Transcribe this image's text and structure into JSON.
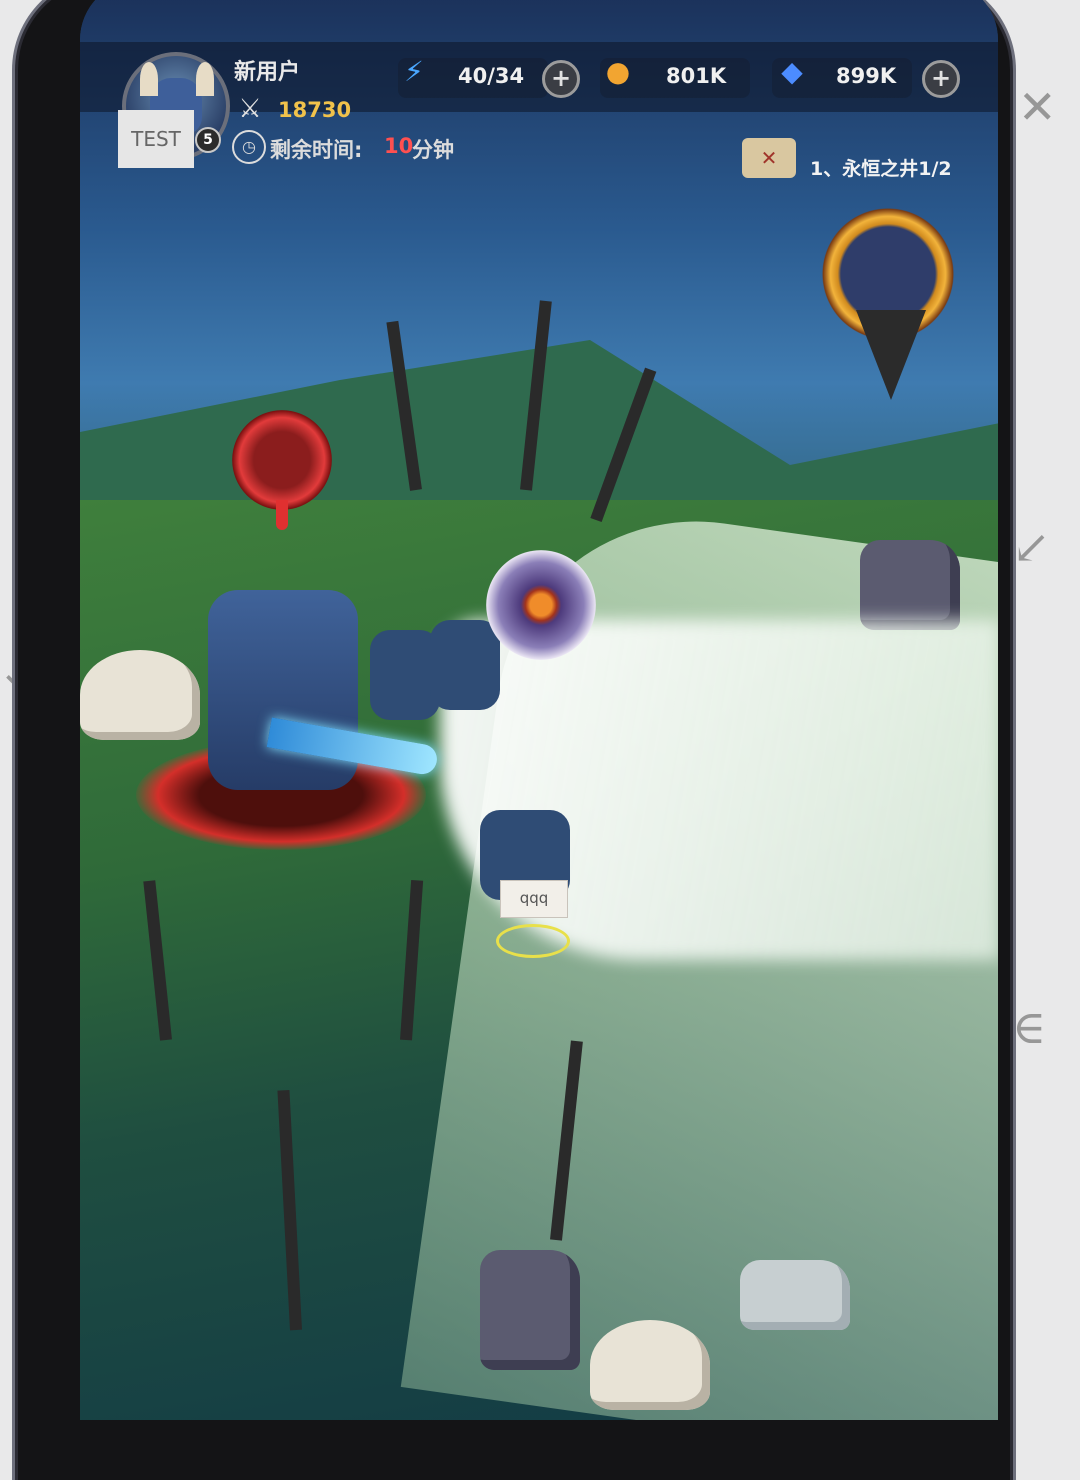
{
  "player": {
    "name": "新用户",
    "power": "18730",
    "level": "5",
    "test_badge": "TEST",
    "time_label": "剩余时间:",
    "time_value": "10",
    "time_unit": "分钟"
  },
  "resources": {
    "energy": "40/34",
    "gold": "801K",
    "gems": "899K"
  },
  "quest": {
    "text": "1、永恒之井1/2"
  },
  "map": {
    "name_tag": "qqq"
  },
  "icons": {
    "energy": "lightning-icon",
    "gold": "coin-icon",
    "gems": "crystal-icon",
    "plus": "plus-icon",
    "power": "crossed-swords-icon",
    "timer": "clock-icon",
    "quest": "map-scroll-icon"
  }
}
